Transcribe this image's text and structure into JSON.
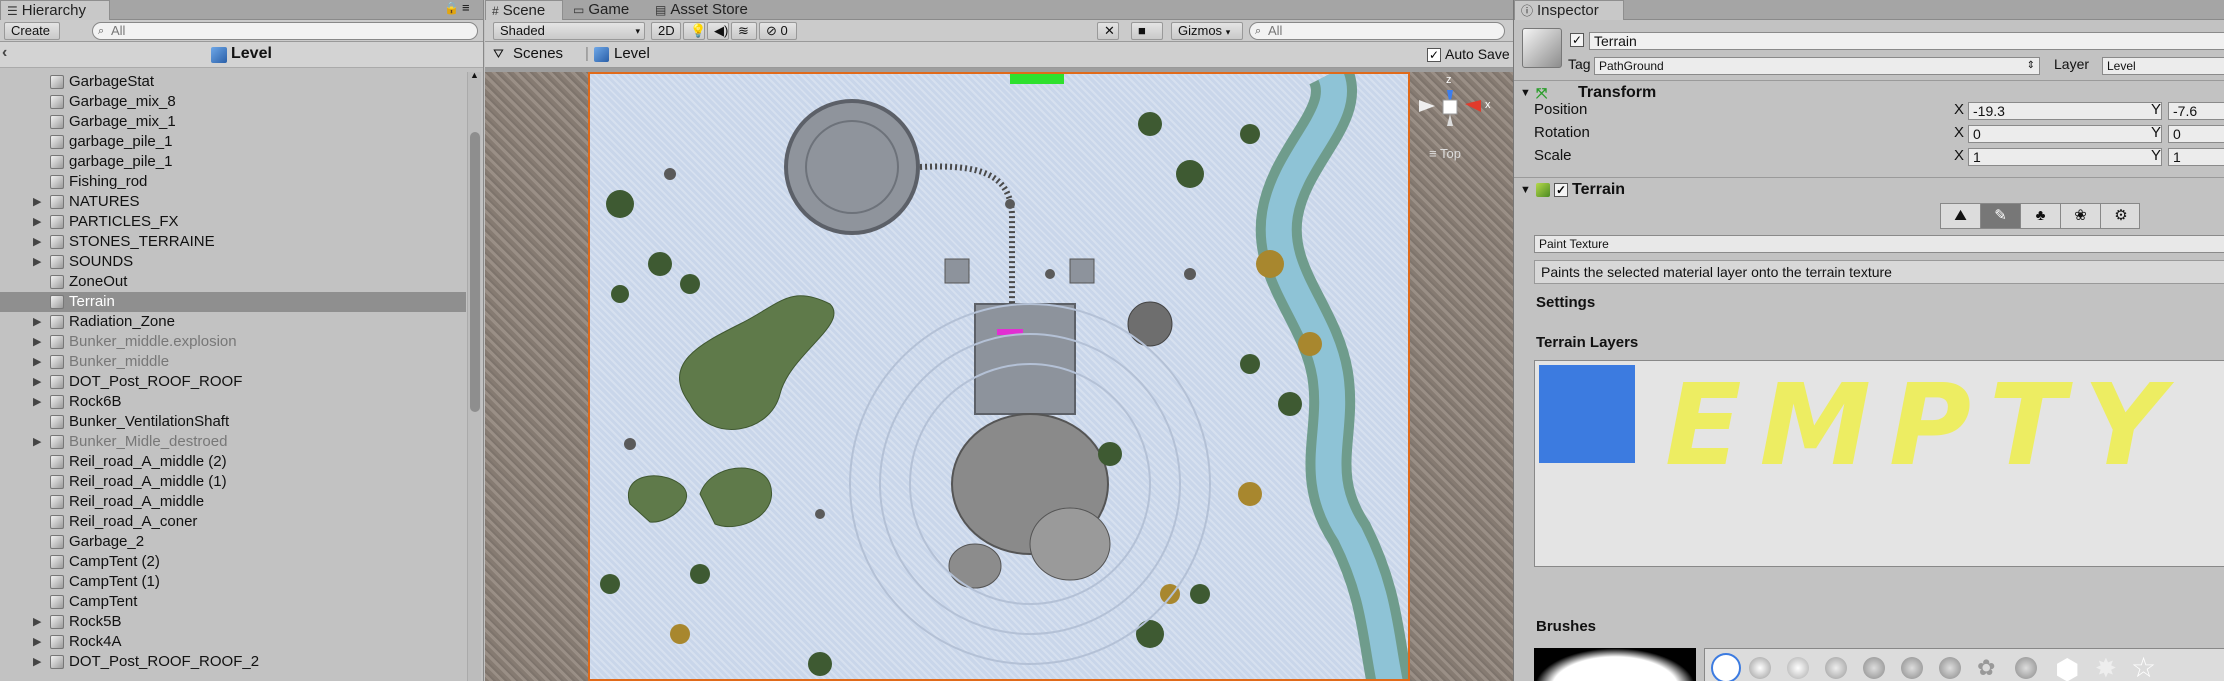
{
  "hierarchy": {
    "tab": "Hierarchy",
    "create": "Create",
    "search_placeholder": "All",
    "scene_name": "Level",
    "items": [
      {
        "label": "GarbageStat",
        "arrow": "",
        "style": ""
      },
      {
        "label": "Garbage_mix_8",
        "arrow": "",
        "style": ""
      },
      {
        "label": "Garbage_mix_1",
        "arrow": "",
        "style": ""
      },
      {
        "label": "garbage_pile_1",
        "arrow": "",
        "style": ""
      },
      {
        "label": "garbage_pile_1",
        "arrow": "",
        "style": ""
      },
      {
        "label": "Fishing_rod",
        "arrow": "",
        "style": ""
      },
      {
        "label": "NATURES",
        "arrow": "▶",
        "style": ""
      },
      {
        "label": "PARTICLES_FX",
        "arrow": "▶",
        "style": ""
      },
      {
        "label": "STONES_TERRAINE",
        "arrow": "▶",
        "style": ""
      },
      {
        "label": "SOUNDS",
        "arrow": "▶",
        "style": ""
      },
      {
        "label": "ZoneOut",
        "arrow": "",
        "style": ""
      },
      {
        "label": "Terrain",
        "arrow": "",
        "style": "sel"
      },
      {
        "label": "Radiation_Zone",
        "arrow": "▶",
        "style": ""
      },
      {
        "label": "Bunker_middle.explosion",
        "arrow": "▶",
        "style": "dim"
      },
      {
        "label": "Bunker_middle",
        "arrow": "▶",
        "style": "dim"
      },
      {
        "label": "DOT_Post_ROOF_ROOF",
        "arrow": "▶",
        "style": ""
      },
      {
        "label": "Rock6B",
        "arrow": "▶",
        "style": ""
      },
      {
        "label": "Bunker_VentilationShaft",
        "arrow": "",
        "style": ""
      },
      {
        "label": "Bunker_Midle_destroed",
        "arrow": "▶",
        "style": "dim"
      },
      {
        "label": "Reil_road_A_middle (2)",
        "arrow": "",
        "style": ""
      },
      {
        "label": "Reil_road_A_middle (1)",
        "arrow": "",
        "style": ""
      },
      {
        "label": "Reil_road_A_middle",
        "arrow": "",
        "style": ""
      },
      {
        "label": "Reil_road_A_coner",
        "arrow": "",
        "style": ""
      },
      {
        "label": "Garbage_2",
        "arrow": "",
        "style": ""
      },
      {
        "label": "CampTent (2)",
        "arrow": "",
        "style": ""
      },
      {
        "label": "CampTent (1)",
        "arrow": "",
        "style": ""
      },
      {
        "label": "CampTent",
        "arrow": "",
        "style": ""
      },
      {
        "label": "Rock5B",
        "arrow": "▶",
        "style": ""
      },
      {
        "label": "Rock4A",
        "arrow": "▶",
        "style": ""
      },
      {
        "label": "DOT_Post_ROOF_ROOF_2",
        "arrow": "▶",
        "style": ""
      }
    ]
  },
  "scene": {
    "tabs": [
      "Scene",
      "Game",
      "Asset Store"
    ],
    "shading": "Shaded",
    "mode_2d": "2D",
    "fx_count": "0",
    "gizmos": "Gizmos",
    "search_placeholder": "All",
    "crumb_scenes": "Scenes",
    "crumb_level": "Level",
    "auto_save": "Auto Save",
    "gizmo_view": "Top",
    "axis_y": "y",
    "axis_x": "x",
    "axis_z": "z"
  },
  "inspector": {
    "tab": "Inspector",
    "name": "Terrain",
    "tag_label": "Tag",
    "tag_value": "PathGround",
    "layer_label": "Layer",
    "layer_value": "Level",
    "transform": {
      "title": "Transform",
      "position_label": "Position",
      "rotation_label": "Rotation",
      "scale_label": "Scale",
      "x": "X",
      "y": "Y",
      "pos_x": "-19.3",
      "pos_y": "-7.6",
      "rot_x": "0",
      "rot_y": "0",
      "scale_x": "1",
      "scale_y": "1"
    },
    "terrain": {
      "title": "Terrain",
      "tool_dropdown": "Paint Texture",
      "description": "Paints the selected material layer onto the terrain texture",
      "settings": "Settings",
      "layers_title": "Terrain Layers",
      "empty_text": "EMPTY",
      "brushes_title": "Brushes"
    },
    "colors": {
      "layer_swatch": "#3c7be0",
      "empty_paint": "#eeee55"
    }
  }
}
